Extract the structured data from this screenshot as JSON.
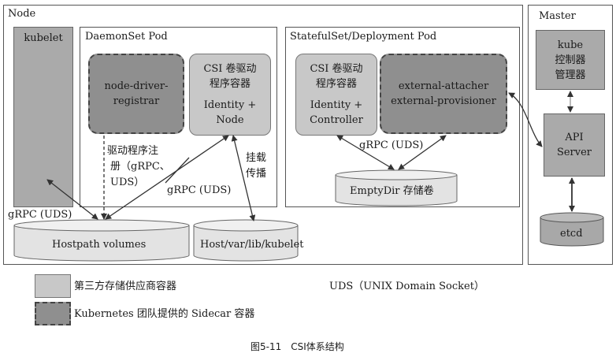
{
  "node": {
    "title": "Node",
    "kubelet": "kubelet",
    "daemonset": {
      "title": "DaemonSet Pod",
      "registrar_line1": "node-driver-",
      "registrar_line2": "registrar",
      "csi_line1": "CSI 卷驱动",
      "csi_line2": "程序容器",
      "csi_line3": "Identity +",
      "csi_line4": "Node"
    },
    "statefulset": {
      "title": "StatefulSet/Deployment Pod",
      "csi_line1": "CSI 卷驱动",
      "csi_line2": "程序容器",
      "csi_line3": "Identity +",
      "csi_line4": "Controller",
      "sidecar_line1": "external-attacher",
      "sidecar_line2": "external-provisioner",
      "emptydir": "EmptyDir 存储卷",
      "grpc_label": "gRPC (UDS)"
    },
    "labels": {
      "driver_reg_line1": "驱动程序注",
      "driver_reg_line2": "册（gRPC、",
      "driver_reg_line3": "UDS）",
      "grpc_uds_mid": "gRPC (UDS)",
      "mount_line1": "挂载",
      "mount_line2": "传播",
      "grpc_uds_left": "gRPC (UDS)"
    },
    "hostpath": "Hostpath volumes",
    "host_kubelet": "Host/var/lib/kubelet"
  },
  "master": {
    "title": "Master",
    "controller_line1": "kube",
    "controller_line2": "控制器",
    "controller_line3": "管理器",
    "api_line1": "API",
    "api_line2": "Server",
    "etcd": "etcd"
  },
  "legend": {
    "third_party": "第三方存储供应商容器",
    "sidecar": "Kubernetes 团队提供的 Sidecar 容器",
    "uds_note": "UDS（UNIX Domain Socket）"
  },
  "caption": "图5-11　CSI体系结构"
}
